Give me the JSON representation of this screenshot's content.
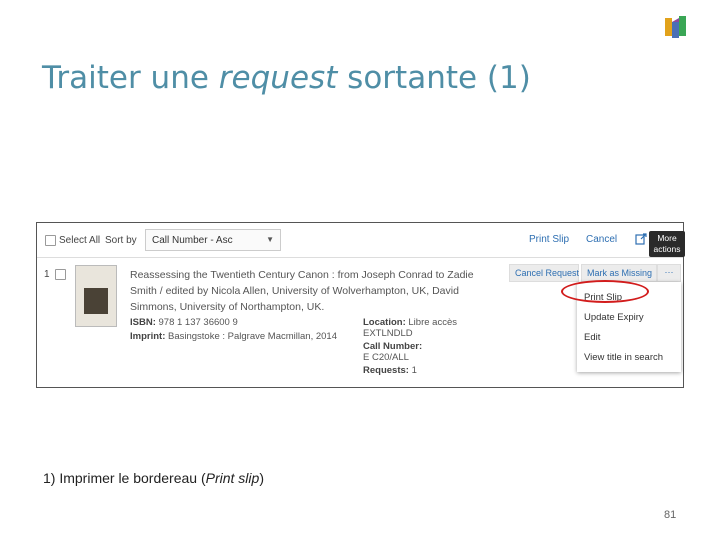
{
  "slide": {
    "title_before": "Traiter une ",
    "title_italic": "request",
    "title_after": " sortante (1)",
    "caption_before": "1) Imprimer le bordereau (",
    "caption_italic": "Print slip",
    "caption_after": ")",
    "page_number": "81"
  },
  "toolbar": {
    "select_all_label": "Select All",
    "sort_by_label": "Sort by",
    "sort_value": "Call Number - Asc",
    "print_slip_label": "Print Slip",
    "cancel_label": "Cancel",
    "more_actions_tooltip_line1": "More",
    "more_actions_tooltip_line2": "actions"
  },
  "record": {
    "index": "1",
    "title_line1": "Reassessing the Twentieth Century Canon : from Joseph Conrad to Zadie",
    "title_line2": "Smith / edited by Nicola Allen, University of Wolverhampton, UK, David",
    "title_line3": "Simmons, University of Northampton, UK.",
    "isbn_label": "ISBN:",
    "isbn_value": "978 1 137 36600 9",
    "imprint_label": "Imprint:",
    "imprint_value": "Basingstoke : Palgrave Macmillan, 2014",
    "location_label": "Location:",
    "location_value": "Libre accès",
    "location_code": "EXTLNDLD",
    "call_number_label": "Call Number:",
    "call_number_value": "E C20/ALL",
    "requests_label": "Requests:",
    "requests_value": "1",
    "cancel_request_label": "Cancel Request",
    "mark_missing_label": "Mark as Missing",
    "more_label": "···"
  },
  "menu": {
    "items": [
      "Print Slip",
      "Update Expiry",
      "Edit",
      "View title in search"
    ]
  },
  "colors": {
    "title": "#4f8ea6",
    "link": "#2e6fb2",
    "highlight_circle": "#d21c1c"
  }
}
